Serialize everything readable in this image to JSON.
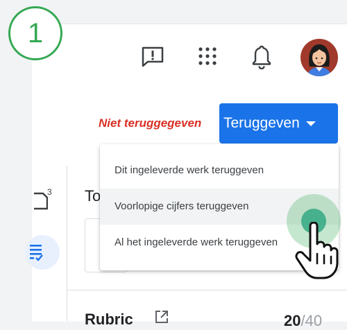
{
  "step": {
    "number": "1"
  },
  "topbar": {
    "icons": [
      "feedback-icon",
      "apps-grid-icon",
      "notifications-bell-icon"
    ],
    "avatar": "user-avatar"
  },
  "header": {
    "status_text": "Niet teruggegeven",
    "return_button_label": "Teruggeven",
    "status_color": "#d93025",
    "accent_color": "#1a73e8"
  },
  "dropdown": {
    "items": [
      {
        "label": "Dit ingeleverde werk teruggeven"
      },
      {
        "label": "Voorlopige cijfers teruggeven"
      },
      {
        "label": "Al het ingeleverde werk teruggeven"
      }
    ]
  },
  "sidebar": {
    "doc_count": "3",
    "icons": [
      "document-icon",
      "rubric-checklist-icon"
    ]
  },
  "card": {
    "title_partial": "To"
  },
  "rubric": {
    "label": "Rubric",
    "score": "20",
    "total": "/40"
  }
}
